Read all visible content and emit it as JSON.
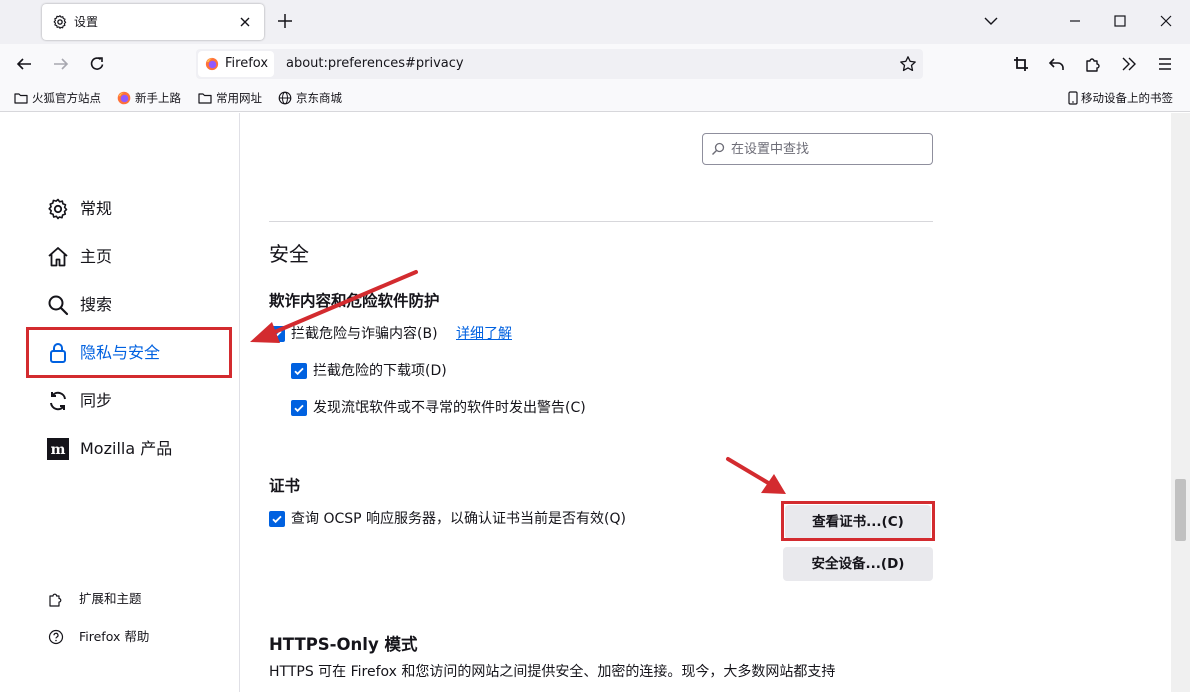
{
  "tab": {
    "title": "设置",
    "icon": "gear-icon"
  },
  "window_controls": [
    "chevron-down-icon",
    "minimize-icon",
    "maximize-icon",
    "close-icon"
  ],
  "urlbar": {
    "identity_label": "Firefox",
    "url": "about:preferences#privacy"
  },
  "bookmarks": [
    {
      "label": "火狐官方站点",
      "icon": "folder-icon"
    },
    {
      "label": "新手上路",
      "icon": "firefox-icon"
    },
    {
      "label": "常用网址",
      "icon": "folder-icon"
    },
    {
      "label": "京东商城",
      "icon": "globe-icon"
    }
  ],
  "mobile_bookmarks": "移动设备上的书签",
  "sidebar": {
    "items": [
      {
        "label": "常规",
        "icon": "gear-icon"
      },
      {
        "label": "主页",
        "icon": "home-icon"
      },
      {
        "label": "搜索",
        "icon": "search-icon"
      },
      {
        "label": "隐私与安全",
        "icon": "lock-icon",
        "selected": true
      },
      {
        "label": "同步",
        "icon": "sync-icon"
      },
      {
        "label": "Mozilla 产品",
        "icon": "mozilla-icon"
      }
    ],
    "footer": [
      {
        "label": "扩展和主题",
        "icon": "puzzle-icon"
      },
      {
        "label": "Firefox 帮助",
        "icon": "help-icon"
      }
    ]
  },
  "search": {
    "placeholder": "在设置中查找"
  },
  "security": {
    "heading": "安全",
    "phishing": {
      "title": "欺诈内容和危险软件防护",
      "block_dangerous": "拦截危险与诈骗内容(B)",
      "learn_more": "详细了解",
      "block_downloads": "拦截危险的下载项(D)",
      "warn_unwanted": "发现流氓软件或不寻常的软件时发出警告(C)"
    },
    "certificates": {
      "title": "证书",
      "ocsp": "查询 OCSP 响应服务器，以确认证书当前是否有效(Q)",
      "view_button": "查看证书...(C)",
      "devices_button": "安全设备...(D)"
    },
    "https_only": {
      "title": "HTTPS-Only 模式",
      "description": "HTTPS 可在 Firefox 和您访问的网站之间提供安全、加密的连接。现今，大多数网站都支持"
    }
  },
  "colors": {
    "accent": "#0061e0",
    "annotation_red": "#d32b2f",
    "chrome_bg": "#f0f0f4"
  }
}
